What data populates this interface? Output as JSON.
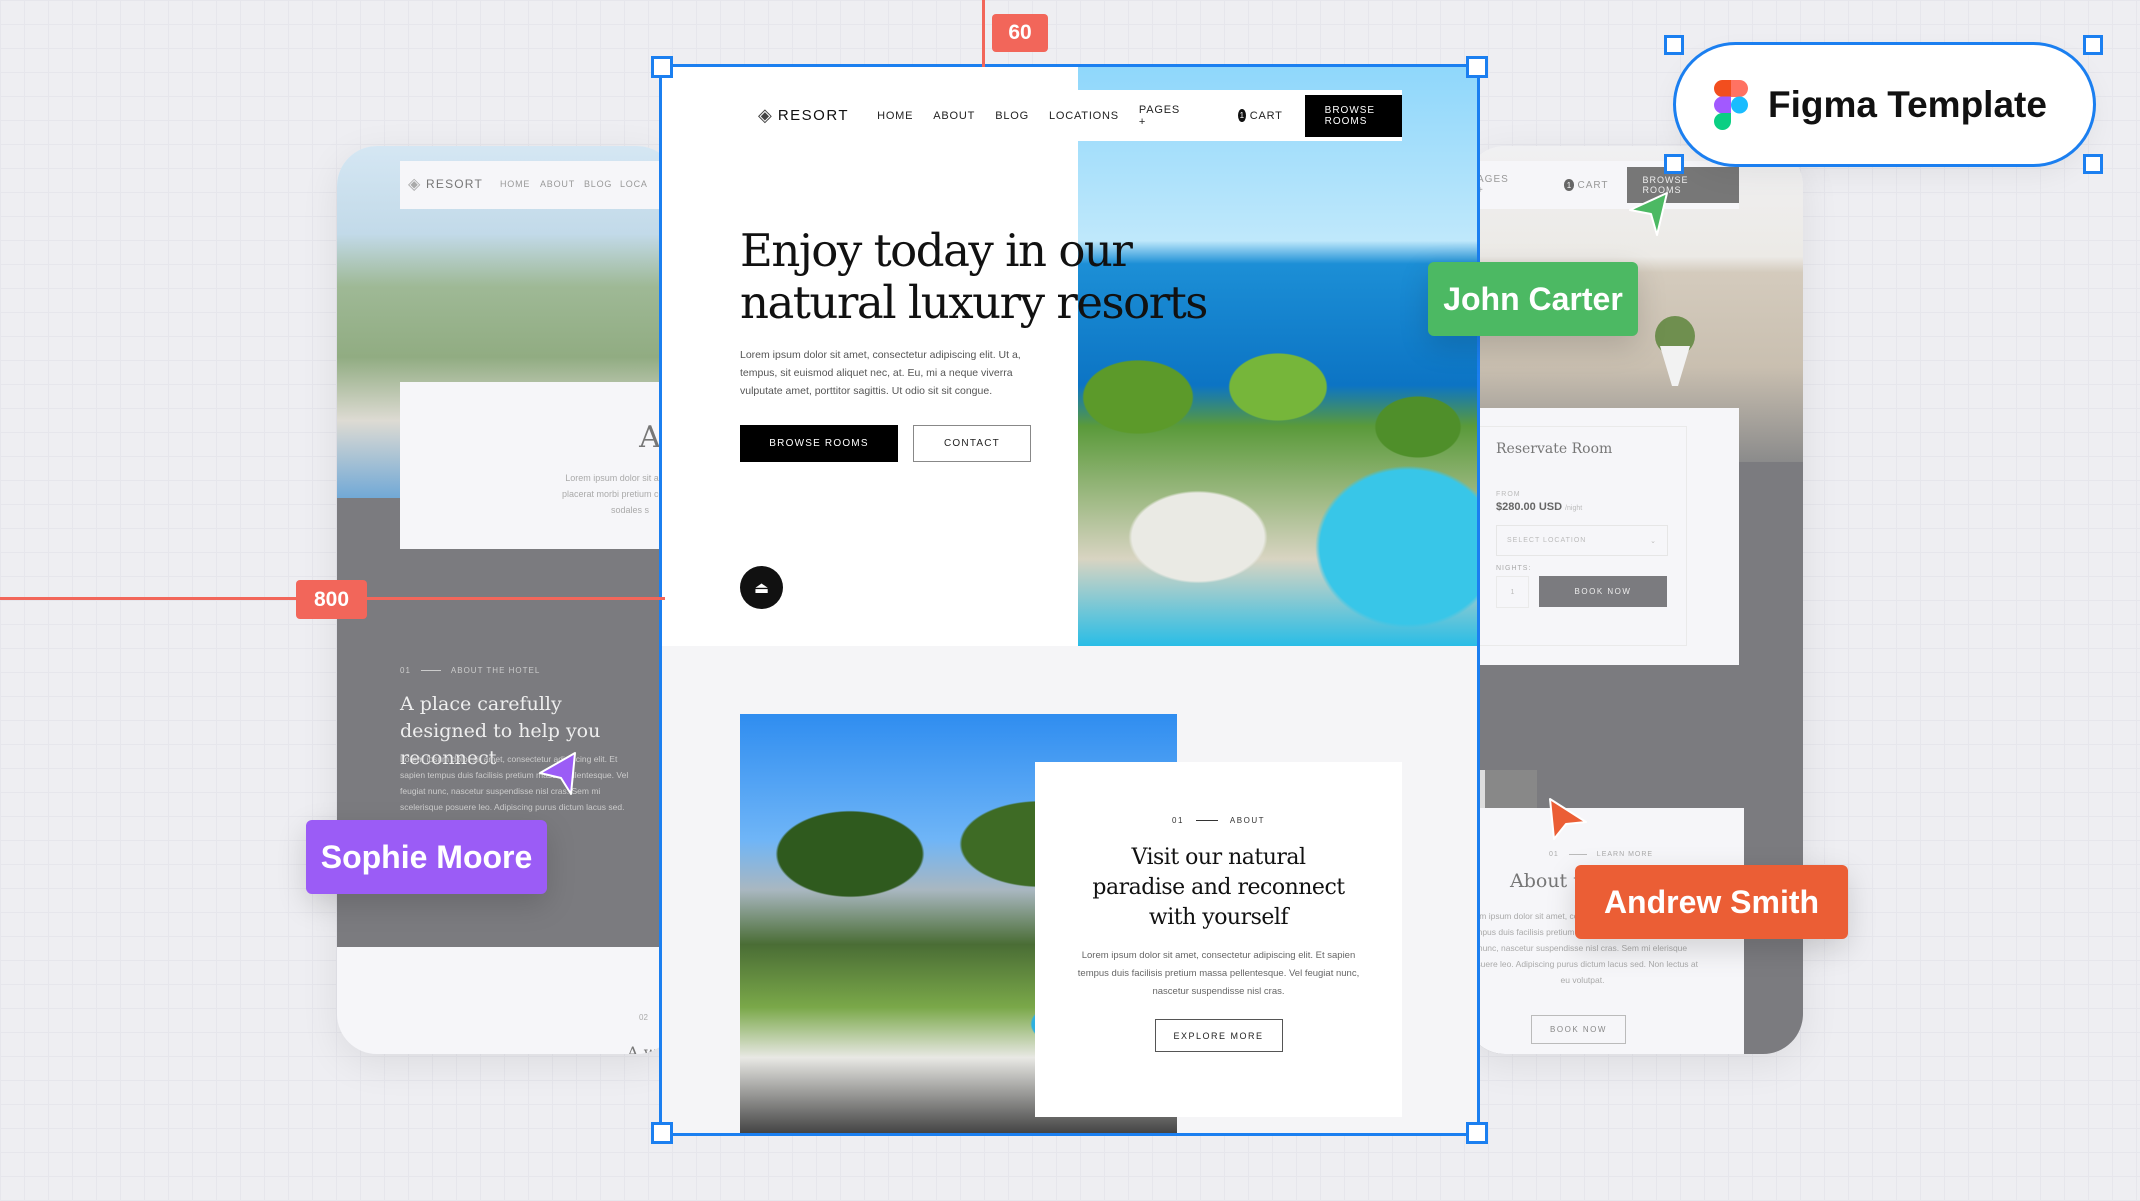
{
  "guides": {
    "vertical_value": "60",
    "horizontal_value": "800",
    "color": "#f2665a"
  },
  "badge": {
    "text": "Figma Template"
  },
  "collaborators": [
    {
      "name": "John Carter",
      "color": "#4cb963"
    },
    {
      "name": "Sophie Moore",
      "color": "#9b5cf6"
    },
    {
      "name": "Andrew Smith",
      "color": "#eb5e35"
    }
  ],
  "main": {
    "logo": "RESORT",
    "nav": [
      "HOME",
      "ABOUT",
      "BLOG",
      "LOCATIONS",
      "PAGES +"
    ],
    "cart_count": "1",
    "cart_label": "CART",
    "browse_button": "BROWSE ROOMS",
    "hero": {
      "title_line1": "Enjoy today in our",
      "title_line2": "natural luxury resorts",
      "text": "Lorem ipsum dolor sit amet, consectetur adipiscing elit. Ut a, tempus, sit euismod aliquet nec, at. Eu, mi a neque viverra vulputate amet, porttitor sagittis. Ut odio sit sit congue.",
      "primary": "BROWSE ROOMS",
      "secondary": "CONTACT"
    },
    "about": {
      "number": "01",
      "label": "ABOUT",
      "title": "Visit our natural paradise and reconnect with yourself",
      "text": "Lorem ipsum dolor sit amet, consectetur adipiscing elit. Et sapien tempus duis facilisis pretium massa pellentesque. Vel feugiat nunc, nascetur suspendisse nisl cras.",
      "button": "EXPLORE MORE"
    }
  },
  "left": {
    "logo": "RESORT",
    "nav": [
      "HOME",
      "ABOUT",
      "BLOG",
      "LOCA"
    ],
    "card_title": "Ab",
    "card_text": "Lorem ipsum dolor sit amet, nisl, placerat morbi pretium consequat, sodales s",
    "number": "01",
    "label": "ABOUT THE HOTEL",
    "title": "A place carefully designed to help you reconnect",
    "text": "Lorem ipsum dolor sit amet, consectetur adipiscing elit. Et sapien tempus duis facilisis pretium massa pellentesque. Vel feugiat nunc, nascetur suspendisse nisl cras. Sem mi scelerisque posuere leo. Adipiscing purus dictum lacus sed.",
    "number2": "02",
    "title2": "A w"
  },
  "right": {
    "nav_partial": "AGES +",
    "cart_count": "1",
    "cart_label": "CART",
    "browse_button": "BROWSE ROOMS",
    "reserve": {
      "title": "Reservate Room",
      "from_label": "FROM",
      "price": "$280.00 USD",
      "per": "/night",
      "location_placeholder": "SELECT LOCATION",
      "nights_label": "NIGHTS:",
      "nights_value": "1",
      "book": "BOOK NOW"
    },
    "number": "01",
    "label": "LEARN MORE",
    "title": "About t",
    "text": "orem ipsum dolor sit amet, consectetur adipiscing elit. Et pien tempus duis facilisis pretium massa pellentesque. Vel feugiat nunc, nascetur suspendisse nisl cras. Sem mi elerisque posuere leo. Adipiscing purus dictum lacus sed. Non lectus at eu volutpat.",
    "button": "BOOK NOW"
  }
}
